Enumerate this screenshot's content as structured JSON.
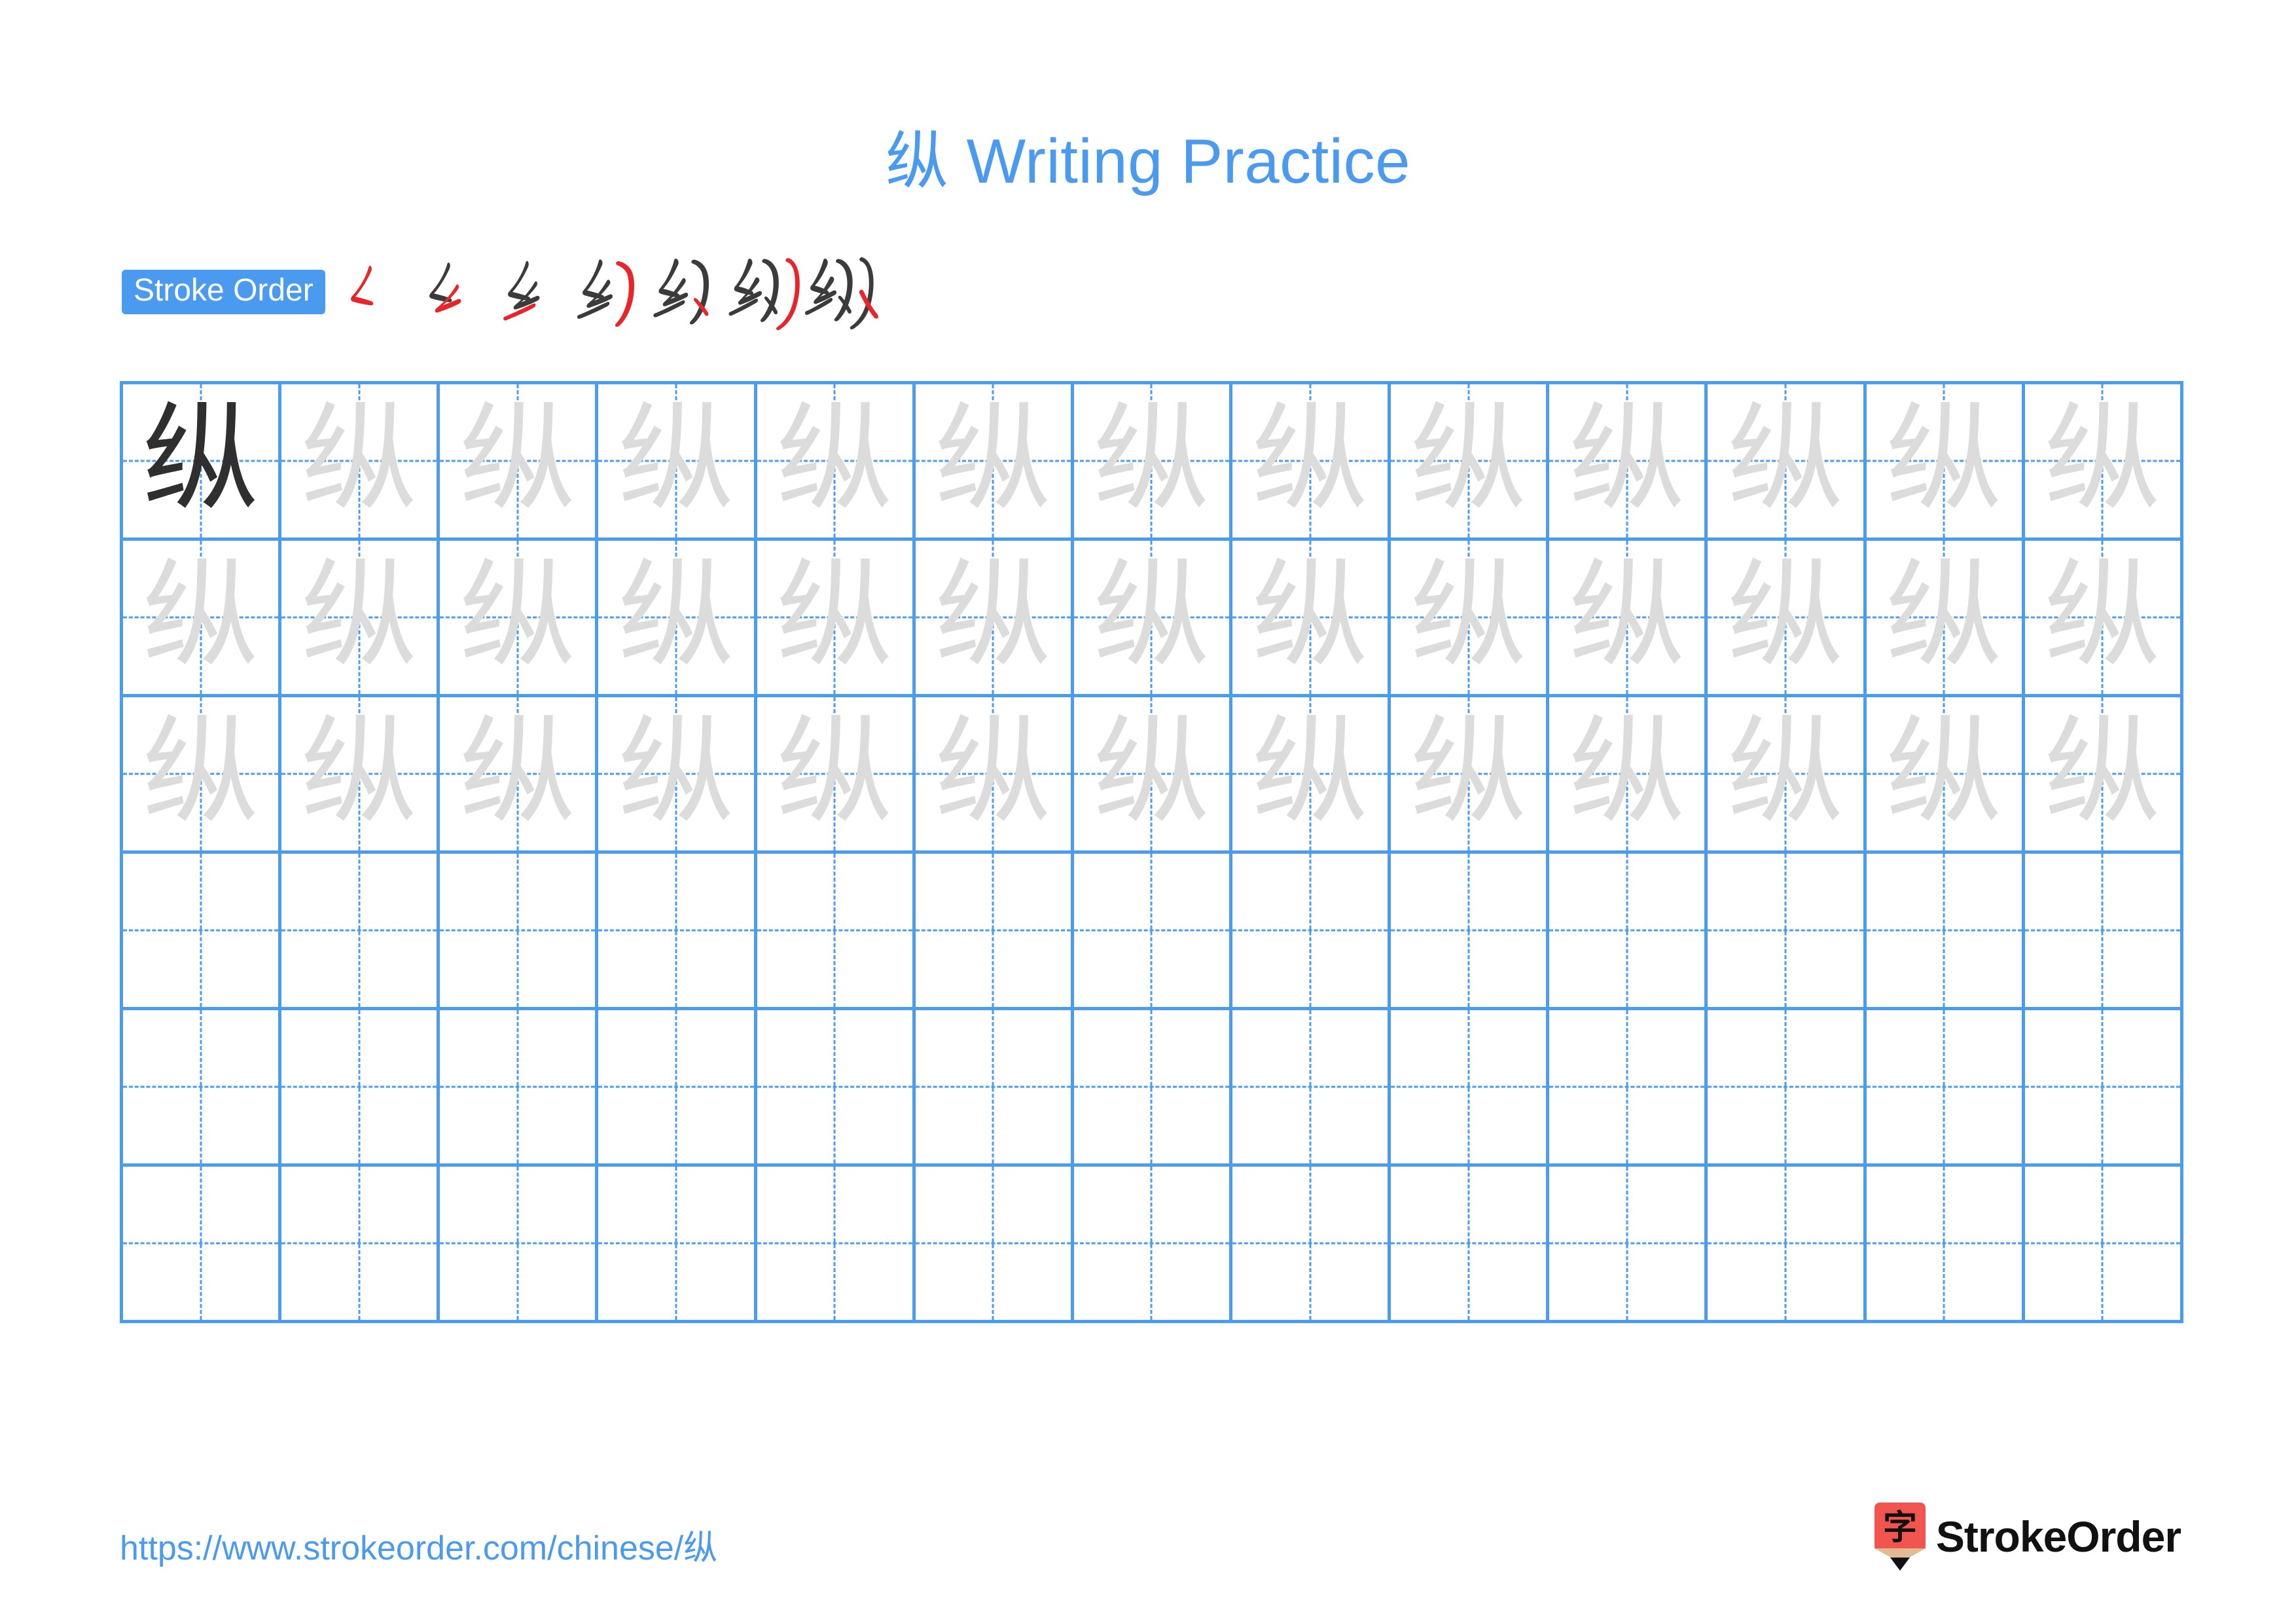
{
  "character": "纵",
  "title": "纵 Writing Practice",
  "colors": {
    "accent_blue": "#4a9bef",
    "grid_blue": "#4a9cef",
    "trace_gray": "#dcdcdc",
    "model_ink": "#2f2f2f",
    "stroke_new": "#e8262a",
    "stroke_old": "#3b3b3b",
    "logo_red": "#f2544f",
    "logo_wood": "#e0bc94",
    "logo_tip": "#111111"
  },
  "stroke_order": {
    "label": "Stroke Order",
    "total_strokes": 7,
    "steps": [
      {
        "index": 1,
        "name": "stroke-step-1",
        "strokes_done": 1
      },
      {
        "index": 2,
        "name": "stroke-step-2",
        "strokes_done": 2
      },
      {
        "index": 3,
        "name": "stroke-step-3",
        "strokes_done": 3
      },
      {
        "index": 4,
        "name": "stroke-step-4",
        "strokes_done": 4
      },
      {
        "index": 5,
        "name": "stroke-step-5",
        "strokes_done": 5
      },
      {
        "index": 6,
        "name": "stroke-step-6",
        "strokes_done": 6
      },
      {
        "index": 7,
        "name": "stroke-step-7",
        "strokes_done": 7
      }
    ]
  },
  "grid": {
    "columns": 13,
    "rows": 6,
    "rows_data": [
      {
        "row": 1,
        "cells": [
          "model",
          "trace",
          "trace",
          "trace",
          "trace",
          "trace",
          "trace",
          "trace",
          "trace",
          "trace",
          "trace",
          "trace",
          "trace"
        ]
      },
      {
        "row": 2,
        "cells": [
          "trace",
          "trace",
          "trace",
          "trace",
          "trace",
          "trace",
          "trace",
          "trace",
          "trace",
          "trace",
          "trace",
          "trace",
          "trace"
        ]
      },
      {
        "row": 3,
        "cells": [
          "trace",
          "trace",
          "trace",
          "trace",
          "trace",
          "trace",
          "trace",
          "trace",
          "trace",
          "trace",
          "trace",
          "trace",
          "trace"
        ]
      },
      {
        "row": 4,
        "cells": [
          "empty",
          "empty",
          "empty",
          "empty",
          "empty",
          "empty",
          "empty",
          "empty",
          "empty",
          "empty",
          "empty",
          "empty",
          "empty"
        ]
      },
      {
        "row": 5,
        "cells": [
          "empty",
          "empty",
          "empty",
          "empty",
          "empty",
          "empty",
          "empty",
          "empty",
          "empty",
          "empty",
          "empty",
          "empty",
          "empty"
        ]
      },
      {
        "row": 6,
        "cells": [
          "empty",
          "empty",
          "empty",
          "empty",
          "empty",
          "empty",
          "empty",
          "empty",
          "empty",
          "empty",
          "empty",
          "empty",
          "empty"
        ]
      }
    ]
  },
  "footer": {
    "url": "https://www.strokeorder.com/chinese/纵",
    "brand": "StrokeOrder",
    "logo_glyph": "字"
  }
}
